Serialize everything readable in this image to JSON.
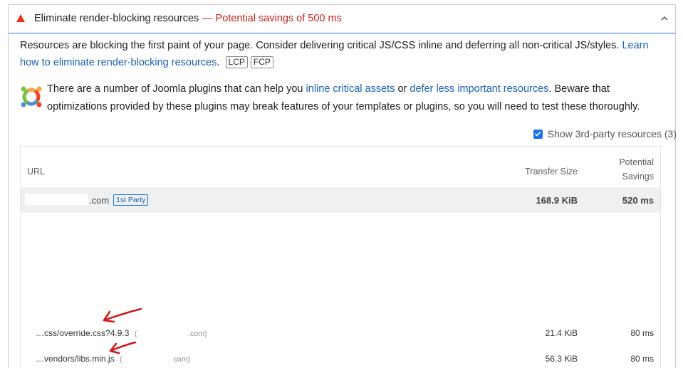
{
  "audit": {
    "title": "Eliminate render-blocking resources",
    "savings": "— Potential savings of 500 ms"
  },
  "description": {
    "text": "Resources are blocking the first paint of your page. Consider delivering critical JS/CSS inline and deferring all non-critical JS/styles.",
    "link": "Learn how to eliminate render-blocking resources",
    "link_suffix": ".",
    "tags": [
      "LCP",
      "FCP"
    ]
  },
  "plugin_note": {
    "prefix": "There are a number of Joomla plugins that can help you",
    "link1": "inline critical assets",
    "middle": "or",
    "link2": "defer less important resources",
    "suffix": ". Beware that optimizations provided by these plugins may break features of your templates or plugins, so you will need to test these thoroughly."
  },
  "third_party_toggle": {
    "label": "Show 3rd-party resources (3)",
    "checked": true
  },
  "table": {
    "headers": {
      "url": "URL",
      "size": "Transfer Size",
      "savings_line1": "Potential",
      "savings_line2": "Savings"
    },
    "group": {
      "domain": ".com",
      "badge": "1st Party",
      "size": "168.9 KiB",
      "savings": "520 ms"
    },
    "rows": [
      {
        "url": "…css/override.css?4.9.3",
        "host_prefix": "(",
        "host_suffix": ".com)",
        "size": "21.4 KiB",
        "savings": "80 ms"
      },
      {
        "url": "…vendors/libs.min.js",
        "host_prefix": "(",
        "host_suffix": "com)",
        "size": "56.3 KiB",
        "savings": "80 ms"
      }
    ]
  },
  "colors": {
    "accent": "#1a73e8",
    "warning": "#e8311d",
    "savings": "#c5221f",
    "annotation": "#d0181a"
  }
}
